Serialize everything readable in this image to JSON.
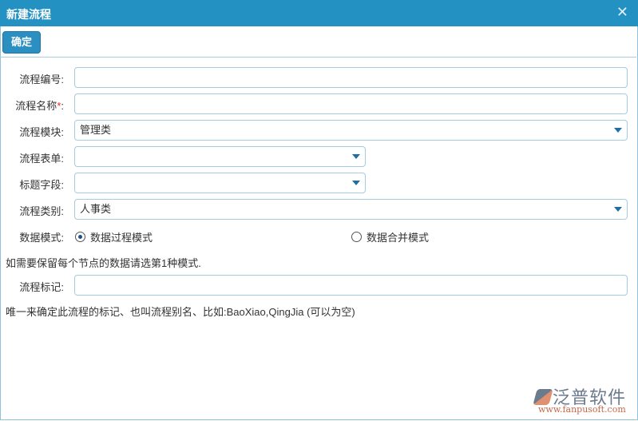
{
  "dialog": {
    "title": "新建流程"
  },
  "toolbar": {
    "ok_label": "确定"
  },
  "form": {
    "code": {
      "label": "流程编号:",
      "value": ""
    },
    "name": {
      "label": "流程名称",
      "required": "*",
      "colon": ":",
      "value": ""
    },
    "module": {
      "label": "流程模块:",
      "value": "管理类"
    },
    "form_sheet": {
      "label": "流程表单:",
      "value": ""
    },
    "title_field": {
      "label": "标题字段:",
      "value": ""
    },
    "category": {
      "label": "流程类别:",
      "value": "人事类"
    },
    "data_mode": {
      "label": "数据模式:",
      "options": [
        "数据过程模式",
        "数据合并模式"
      ],
      "selected": "数据过程模式"
    },
    "mode_note": "如需要保留每个节点的数据请选第1种模式.",
    "tag": {
      "label": "流程标记:",
      "value": ""
    },
    "tag_note": "唯一来确定此流程的标记、也叫流程别名、比如:BaoXiao,QingJia (可以为空)"
  },
  "logo": {
    "name": "泛普软件",
    "url": "www.fanpusoft.com"
  }
}
